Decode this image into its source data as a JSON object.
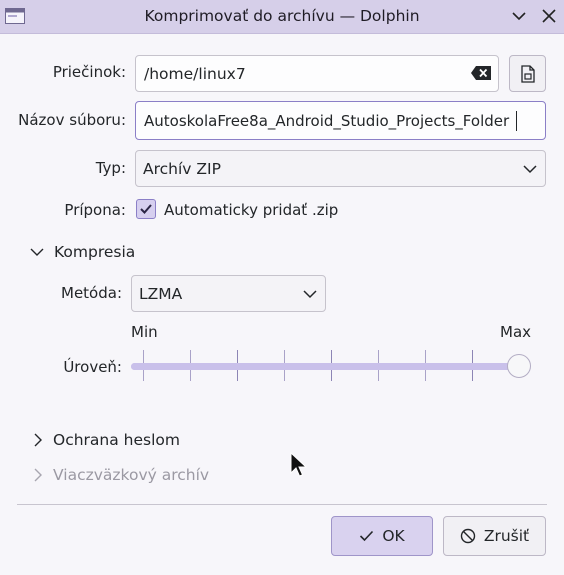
{
  "window": {
    "title": "Komprimovať do archívu — Dolphin"
  },
  "form": {
    "folder": {
      "label": "Priečinok:",
      "value": "/home/linux7"
    },
    "filename": {
      "label": "Názov súboru:",
      "value": "AutoskolaFree8a_Android_Studio_Projects_Folder"
    },
    "type": {
      "label": "Typ:",
      "value": "Archív ZIP"
    },
    "extension": {
      "label": "Prípona:",
      "checkbox_label": "Automaticky pridať .zip",
      "checked": true
    }
  },
  "compression": {
    "section_label": "Kompresia",
    "method": {
      "label": "Metóda:",
      "value": "LZMA"
    },
    "level": {
      "label": "Úroveň:",
      "min_label": "Min",
      "max_label": "Max",
      "value_fraction": 1.0
    }
  },
  "sections": {
    "password": "Ochrana heslom",
    "multivolume": "Viaczväzkový archív"
  },
  "buttons": {
    "ok": "OK",
    "cancel": "Zrušiť"
  },
  "colors": {
    "accent": "#8b7fc7",
    "titlebar": "#d6cfe9"
  }
}
